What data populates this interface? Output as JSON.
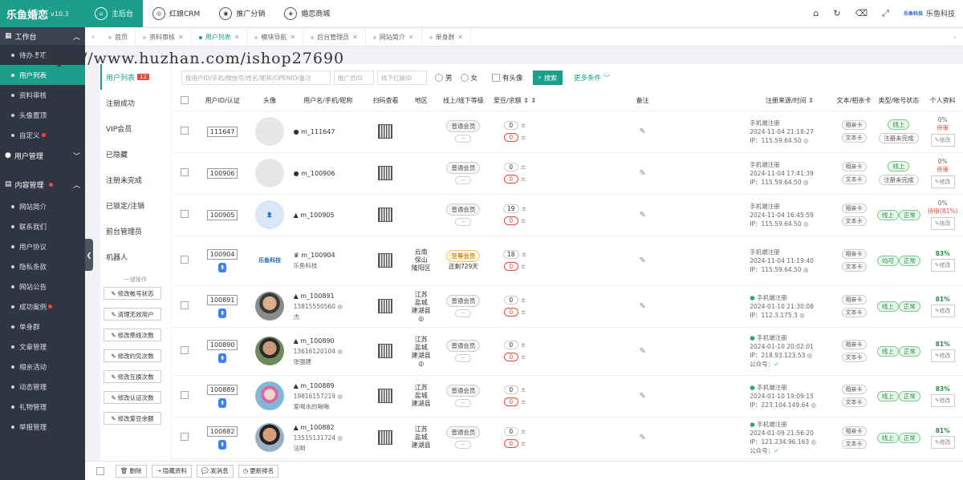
{
  "brand": {
    "name": "乐鱼婚恋",
    "version": "v10.3"
  },
  "topnav": [
    {
      "label": "主后台",
      "icon": "home-circle-icon",
      "active": true
    },
    {
      "label": "红娘CRM",
      "icon": "crm-icon",
      "active": false
    },
    {
      "label": "推广分销",
      "icon": "distribution-icon",
      "active": false
    },
    {
      "label": "婚恋商城",
      "icon": "mall-icon",
      "active": false
    }
  ],
  "company": {
    "logo": "乐鱼科技",
    "name": "乐鱼科技"
  },
  "sidebar": {
    "section_workbench": "工作台",
    "workbench_items": [
      {
        "label": "待办事项"
      },
      {
        "label": "用户列表",
        "active": true
      },
      {
        "label": "资料审核"
      },
      {
        "label": "头像置顶"
      },
      {
        "label": "自定义"
      }
    ],
    "section_users": "用户管理",
    "section_content": "内容管理",
    "content_items": [
      {
        "label": "网站简介"
      },
      {
        "label": "联系我们"
      },
      {
        "label": "用户协议"
      },
      {
        "label": "隐私条款"
      },
      {
        "label": "网站公告"
      },
      {
        "label": "成功案例"
      },
      {
        "label": "单身群"
      },
      {
        "label": "文章管理"
      },
      {
        "label": "相亲活动"
      },
      {
        "label": "动态管理"
      },
      {
        "label": "礼物管理"
      },
      {
        "label": "举报管理"
      }
    ]
  },
  "tabs": [
    {
      "label": "首页"
    },
    {
      "label": "资料审核"
    },
    {
      "label": "用户列表",
      "active": true
    },
    {
      "label": "模块导航"
    },
    {
      "label": "后台管理员"
    },
    {
      "label": "网站简介"
    },
    {
      "label": "单身群"
    }
  ],
  "watermark": "https://www.huzhan.com/ishop27690",
  "submenu": {
    "items": [
      {
        "label": "用户列表",
        "badge": "12",
        "active": true
      },
      {
        "label": "注册成功"
      },
      {
        "label": "VIP会员"
      },
      {
        "label": "已隐藏"
      },
      {
        "label": "注册未完成"
      },
      {
        "label": "已锁定/注销"
      },
      {
        "label": "前台管理员"
      },
      {
        "label": "机器人"
      }
    ],
    "onekey": "一键操作",
    "ops": [
      {
        "label": "修改帐号状态"
      },
      {
        "label": "清理无效用户"
      },
      {
        "label": "修改牵线次数"
      },
      {
        "label": "修改约见次数"
      },
      {
        "label": "修改互换次数"
      },
      {
        "label": "修改认证次数"
      },
      {
        "label": "修改爱豆余额"
      }
    ]
  },
  "filter": {
    "search_placeholder": "按用户ID/手机/微信号/姓名/昵称/OPENID/备注",
    "staff_placeholder": "推广员ID",
    "matchmaker_placeholder": "线下红娘ID",
    "male": "男",
    "female": "女",
    "has_avatar": "有头像",
    "search_btn": "搜索",
    "more": "更多条件"
  },
  "table": {
    "headers": [
      "",
      "用户ID/认证",
      "头像",
      "用户名/手机/昵称",
      "扫码查看",
      "地区",
      "线上/线下等级",
      "爱豆/余额",
      "备注",
      "注册来源/时间",
      "文本/相亲卡",
      "类型/帐号状态",
      "个人资料"
    ],
    "rows": [
      {
        "id": "111647",
        "avatar": "grey",
        "name": "m_111647",
        "phone": "",
        "nick": "",
        "region": "",
        "level": "普通会员",
        "level_sub": "--",
        "beans": "0",
        "balance": "0",
        "src": "手机端注册",
        "time": "2024-11-04 21:18:27",
        "ip": "IP：115.59.64.50",
        "wx": false,
        "card": "相亲卡",
        "text": "文本卡",
        "type": "线上",
        "type_grey": false,
        "acct": "注册未完成",
        "pct": "0%",
        "pct_grey": true,
        "pend": "待审",
        "edit": "修改"
      },
      {
        "id": "100906",
        "avatar": "grey",
        "name": "m_100906",
        "phone": "",
        "nick": "",
        "region": "",
        "level": "普通会员",
        "level_sub": "--",
        "beans": "0",
        "balance": "0",
        "src": "手机端注册",
        "time": "2024-11-04 17:41:39",
        "ip": "IP：115.59.64.50",
        "wx": false,
        "card": "相亲卡",
        "text": "文本卡",
        "type": "线上",
        "type_grey": false,
        "acct": "注册未完成",
        "pct": "0%",
        "pct_grey": true,
        "pend": "待审",
        "edit": "修改"
      },
      {
        "id": "100905",
        "avatar": "blue",
        "name": "m_100905",
        "phone": "",
        "nick": "",
        "region": "",
        "level": "普通会员",
        "level_sub": "--",
        "beans": "19",
        "balance": "0",
        "src": "手机端注册",
        "time": "2024-11-04 16:45:59",
        "ip": "IP：115.59.64.50",
        "wx": false,
        "card": "相亲卡",
        "text": "文本卡",
        "type": "线上",
        "type_grey": false,
        "acct": "正常",
        "pct": "0%",
        "pct_grey": true,
        "pend": "待审(81%)",
        "edit": "修改"
      },
      {
        "id": "100904",
        "avatar": "logo",
        "avatar_text": "乐鱼科技",
        "name": "m_100904",
        "phone": "",
        "nick": "乐鱼科技",
        "region": "云南\n保山\n隆阳区",
        "level": "至尊会员",
        "level_gold": true,
        "level_sub": "还剩729天",
        "beans": "18",
        "balance": "0",
        "src": "手机端注册",
        "time": "2024-11-04 11:19:40",
        "ip": "IP：115.59.64.50",
        "wx": false,
        "card": "相亲卡",
        "text": "文本卡",
        "type": "均可",
        "type_grey": false,
        "acct": "正常",
        "pct": "83%",
        "pct_grey": false,
        "pend": "",
        "edit": "修改"
      },
      {
        "id": "100891",
        "avatar": "photo1",
        "name": "m_100891",
        "phone": "13815550560",
        "nick": "杰",
        "region": "江苏\n盐城\n建湖县",
        "level": "普通会员",
        "level_sub": "--",
        "beans": "0",
        "balance": "0",
        "src": "手机端注册",
        "time": "2024-01-10 21:30:08",
        "ip": "IP：112.3.175.3",
        "wx": true,
        "card": "相亲卡",
        "text": "文本卡",
        "type": "线上",
        "type_grey": false,
        "acct": "正常",
        "pct": "81%",
        "pct_grey": false,
        "pend": "",
        "edit": "修改"
      },
      {
        "id": "100890",
        "avatar": "photo2",
        "name": "m_100890",
        "phone": "13616120104",
        "nick": "张强建",
        "region": "江苏\n盐城\n建湖县",
        "level": "普通会员",
        "level_sub": "--",
        "beans": "0",
        "balance": "0",
        "src": "手机端注册",
        "time": "2024-01-10 20:02:01",
        "ip": "IP：218.93.123.53",
        "wx": true,
        "gzh": "公众号：",
        "card": "相亲卡",
        "text": "文本卡",
        "type": "线上",
        "type_grey": false,
        "acct": "正常",
        "pct": "81%",
        "pct_grey": false,
        "pend": "",
        "edit": "修改"
      },
      {
        "id": "100889",
        "avatar": "photo3",
        "name": "m_100889",
        "phone": "19816157219",
        "nick": "爱喝水的啾啾",
        "region": "江苏\n盐城\n建湖县",
        "level": "普通会员",
        "level_sub": "--",
        "beans": "0",
        "balance": "0",
        "src": "手机端注册",
        "time": "2024-01-10 19:09:15",
        "ip": "IP：223.104.149.64",
        "wx": true,
        "card": "相亲卡",
        "text": "文本卡",
        "type": "线上",
        "type_grey": false,
        "acct": "正常",
        "pct": "83%",
        "pct_grey": false,
        "pend": "",
        "edit": "修改"
      },
      {
        "id": "100882",
        "avatar": "photo4",
        "name": "m_100882",
        "phone": "13515131724",
        "nick": "法明",
        "region": "江苏\n盐城\n建湖县",
        "level": "普通会员",
        "level_sub": "--",
        "beans": "0",
        "balance": "0",
        "src": "手机端注册",
        "time": "2024-01-09 21:56:20",
        "ip": "IP：121.234.96.163",
        "wx": true,
        "gzh": "公众号：",
        "card": "相亲卡",
        "text": "文本卡",
        "type": "线上",
        "type_grey": false,
        "acct": "正常",
        "pct": "81%",
        "pct_grey": false,
        "pend": "",
        "edit": "修改"
      }
    ]
  },
  "bottom": [
    {
      "label": "删除"
    },
    {
      "label": "隐藏资料"
    },
    {
      "label": "发消息"
    },
    {
      "label": "更新排名"
    }
  ]
}
